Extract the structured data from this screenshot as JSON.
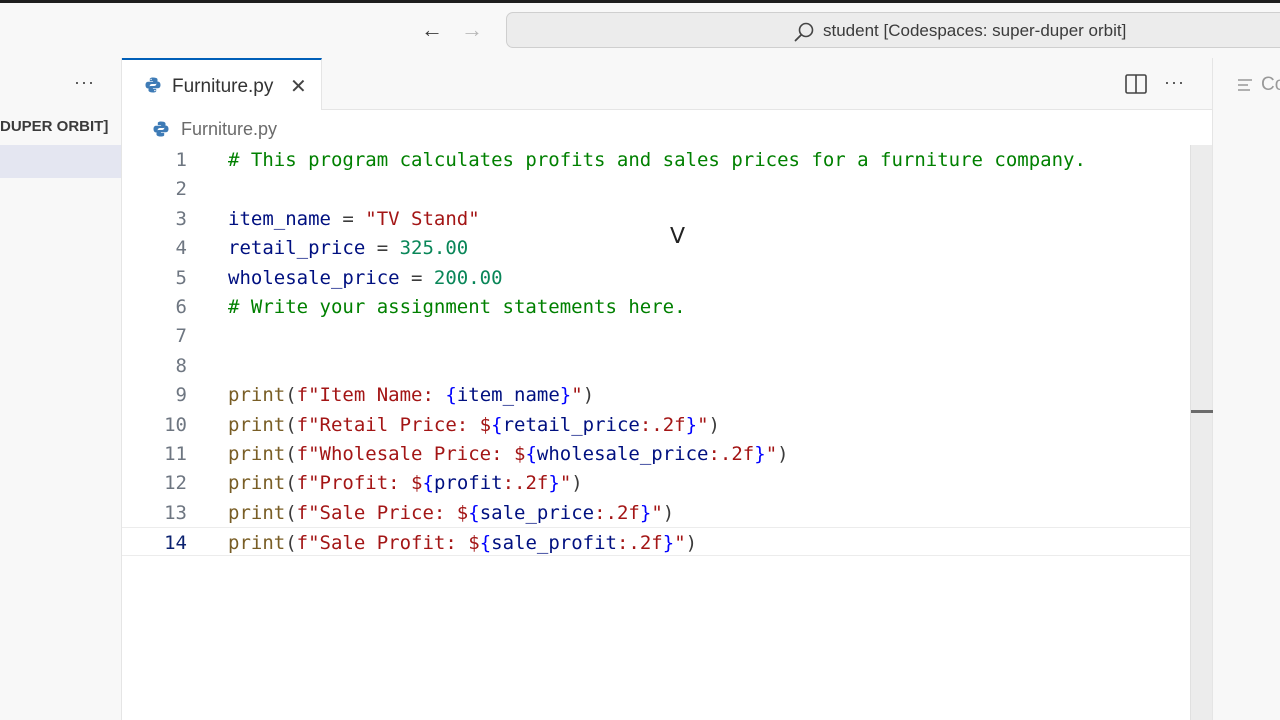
{
  "titlebar": {
    "back_icon": "arrow-left-icon",
    "forward_icon": "arrow-right-icon",
    "command_center_text": "student [Codespaces: super-duper orbit]"
  },
  "sidebar": {
    "more_label": "···",
    "folder_label": "DUPER ORBIT]"
  },
  "tabs": [
    {
      "label": "Furniture.py",
      "close": "✕",
      "active": true
    }
  ],
  "editor_actions": {
    "more_label": "···"
  },
  "right_panel": {
    "label": "Co"
  },
  "breadcrumb": {
    "file": "Furniture.py"
  },
  "code_lines": [
    {
      "num": "1",
      "tokens": [
        [
          "comment",
          "# This program calculates profits and sales prices for a furniture company."
        ]
      ]
    },
    {
      "num": "2",
      "tokens": []
    },
    {
      "num": "3",
      "tokens": [
        [
          "var",
          "item_name"
        ],
        [
          "op",
          " = "
        ],
        [
          "str",
          "\"TV Stand\""
        ]
      ]
    },
    {
      "num": "4",
      "tokens": [
        [
          "var",
          "retail_price"
        ],
        [
          "op",
          " = "
        ],
        [
          "num",
          "325.00"
        ]
      ]
    },
    {
      "num": "5",
      "tokens": [
        [
          "var",
          "wholesale_price"
        ],
        [
          "op",
          " = "
        ],
        [
          "num",
          "200.00"
        ]
      ]
    },
    {
      "num": "6",
      "tokens": [
        [
          "comment",
          "# Write your assignment statements here."
        ]
      ]
    },
    {
      "num": "7",
      "tokens": []
    },
    {
      "num": "8",
      "tokens": []
    },
    {
      "num": "9",
      "tokens": [
        [
          "fn",
          "print"
        ],
        [
          "op",
          "("
        ],
        [
          "str",
          "f\"Item Name: "
        ],
        [
          "brace",
          "{"
        ],
        [
          "var",
          "item_name"
        ],
        [
          "brace",
          "}"
        ],
        [
          "str",
          "\""
        ],
        [
          "op",
          ")"
        ]
      ]
    },
    {
      "num": "10",
      "tokens": [
        [
          "fn",
          "print"
        ],
        [
          "op",
          "("
        ],
        [
          "str",
          "f\"Retail Price: $"
        ],
        [
          "brace",
          "{"
        ],
        [
          "var",
          "retail_price"
        ],
        [
          "str",
          ":.2f"
        ],
        [
          "brace",
          "}"
        ],
        [
          "str",
          "\""
        ],
        [
          "op",
          ")"
        ]
      ]
    },
    {
      "num": "11",
      "tokens": [
        [
          "fn",
          "print"
        ],
        [
          "op",
          "("
        ],
        [
          "str",
          "f\"Wholesale Price: $"
        ],
        [
          "brace",
          "{"
        ],
        [
          "var",
          "wholesale_price"
        ],
        [
          "str",
          ":.2f"
        ],
        [
          "brace",
          "}"
        ],
        [
          "str",
          "\""
        ],
        [
          "op",
          ")"
        ]
      ]
    },
    {
      "num": "12",
      "tokens": [
        [
          "fn",
          "print"
        ],
        [
          "op",
          "("
        ],
        [
          "str",
          "f\"Profit: $"
        ],
        [
          "brace",
          "{"
        ],
        [
          "var",
          "profit"
        ],
        [
          "str",
          ":.2f"
        ],
        [
          "brace",
          "}"
        ],
        [
          "str",
          "\""
        ],
        [
          "op",
          ")"
        ]
      ]
    },
    {
      "num": "13",
      "tokens": [
        [
          "fn",
          "print"
        ],
        [
          "op",
          "("
        ],
        [
          "str",
          "f\"Sale Price: $"
        ],
        [
          "brace",
          "{"
        ],
        [
          "var",
          "sale_price"
        ],
        [
          "str",
          ":.2f"
        ],
        [
          "brace",
          "}"
        ],
        [
          "str",
          "\""
        ],
        [
          "op",
          ")"
        ]
      ]
    },
    {
      "num": "14",
      "tokens": [
        [
          "fn",
          "print"
        ],
        [
          "op",
          "("
        ],
        [
          "str",
          "f\"Sale Profit: $"
        ],
        [
          "brace",
          "{"
        ],
        [
          "var",
          "sale_profit"
        ],
        [
          "str",
          ":.2f"
        ],
        [
          "brace",
          "}"
        ],
        [
          "str",
          "\""
        ],
        [
          "op",
          ")"
        ]
      ]
    }
  ],
  "current_line": "14",
  "colors": {
    "comment": "#008000",
    "function": "#795e26",
    "string": "#a31515",
    "number": "#098658",
    "variable": "#001080",
    "brace": "#0000ff",
    "accent": "#005fb8"
  }
}
